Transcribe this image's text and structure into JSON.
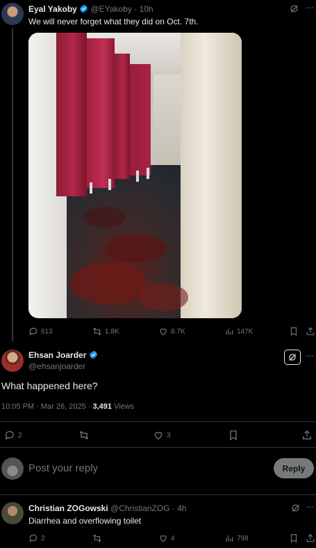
{
  "tweet": {
    "author_name": "Eyal Yakoby",
    "handle": "@EYakoby",
    "separator": "·",
    "time": "10h",
    "text": "We will never forget what they did on Oct. 7th.",
    "actions": {
      "replies": "613",
      "reposts": "1.8K",
      "likes": "8.7K",
      "views": "147K"
    }
  },
  "reply_main": {
    "author_name": "Ehsan Joarder",
    "handle": "@ehsanjoarder",
    "text": "What happened here?",
    "timestamp": "10:05 PM · Mar 26, 2025 · ",
    "views_count": "3,491",
    "views_label": " Views",
    "actions": {
      "replies": "2",
      "likes": "3"
    }
  },
  "composer": {
    "placeholder": "Post your reply",
    "reply_button": "Reply"
  },
  "reply_second": {
    "author_name": "Christian ZOGowski",
    "handle": "@ChristianZOG",
    "separator": "·",
    "time": "4h",
    "text": "Diarrhea and overflowing toilet",
    "actions": {
      "replies": "2",
      "likes": "4",
      "views": "798"
    }
  },
  "colors": {
    "background": "#000000",
    "text": "#e7e9ea",
    "muted": "#71767b",
    "verified": "#1d9bf0",
    "divider": "#2f3336"
  }
}
